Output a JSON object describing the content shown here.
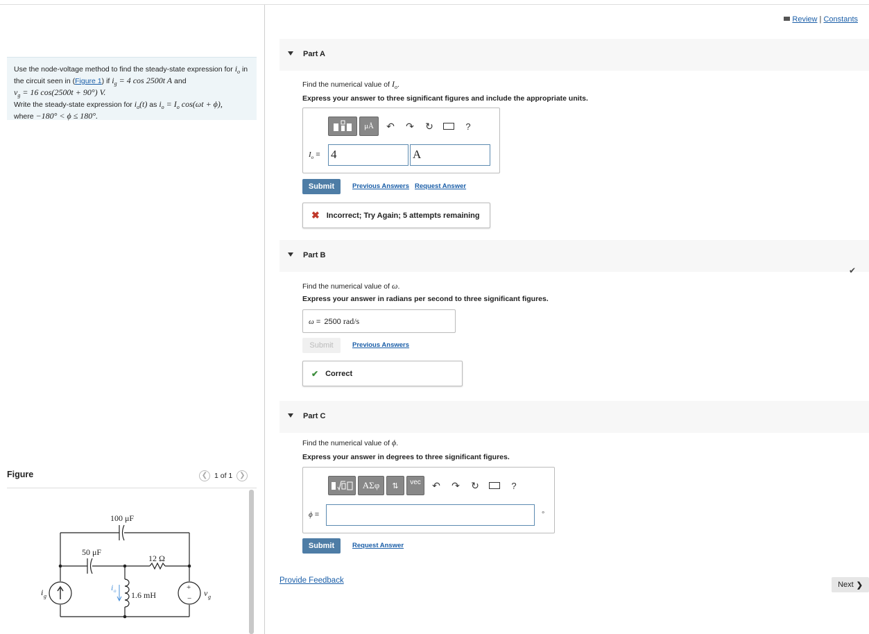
{
  "header": {
    "review": "Review",
    "sep": "|",
    "constants": "Constants"
  },
  "problem": {
    "line1_a": "Use the node-voltage method to find the steady-state expression for ",
    "line1_io": "i",
    "line1_io_sub": "o",
    "line1_b": " in",
    "line2_a": "the circuit seen in (",
    "line2_link": "Figure 1",
    "line2_b": ") if ",
    "line2_eq": "i",
    "line2_eq_sub": "g",
    "line2_eq2": " = 4 cos 2500t A",
    "line2_c": " and",
    "line3_eq": "v",
    "line3_eq_sub": "g",
    "line3_eq2": " = 16 cos(2500t + 90°) V.",
    "line4_a": "Write the steady-state expression for ",
    "line4_eq1": "i",
    "line4_eq1_sub": "o",
    "line4_eq1b": "(t)",
    "line4_b": " as ",
    "line4_eq2": "i",
    "line4_eq2_sub": "o",
    "line4_eq2b": " = I",
    "line4_eq2_sub2": "o",
    "line4_eq2c": " cos(ωt + ϕ),",
    "line5_a": "where ",
    "line5_eq": "−180° < ϕ ≤ 180°."
  },
  "figure": {
    "title": "Figure",
    "pager": "1 of 1",
    "labels": {
      "c100": "100 μF",
      "c50": "50 μF",
      "r12": "12 Ω",
      "l": "1.6 mH",
      "ig": "i",
      "ig_sub": "g",
      "vg": "v",
      "vg_sub": "g",
      "io": "i",
      "io_sub": "o",
      "plus": "+",
      "minus": "−"
    }
  },
  "partA": {
    "label": "Part A",
    "q1_a": "Find the numerical value of ",
    "q1_var": "I",
    "q1_var_sub": "o",
    "q1_b": ".",
    "q2": "Express your answer to three significant figures and include the appropriate units.",
    "toolbar": {
      "units": "μÅ",
      "help": "?"
    },
    "field_label": "I",
    "field_label_sub": "o",
    "field_eq": " =",
    "value": "4",
    "unit": "A",
    "submit": "Submit",
    "prev": "Previous Answers",
    "request": "Request Answer",
    "feedback": "Incorrect; Try Again; 5 attempts remaining"
  },
  "partB": {
    "label": "Part B",
    "q1_a": "Find the numerical value of ",
    "q1_var": "ω",
    "q1_b": ".",
    "q2": "Express your answer in radians per second to three significant figures.",
    "field_label": "ω",
    "field_eq": " = ",
    "value": "2500",
    "unit": "rad/s",
    "submit": "Submit",
    "prev": "Previous Answers",
    "feedback": "Correct"
  },
  "partC": {
    "label": "Part C",
    "q1_a": "Find the numerical value of ",
    "q1_var": "ϕ",
    "q1_b": ".",
    "q2": "Express your answer in degrees to three significant figures.",
    "toolbar": {
      "greek": "AΣφ",
      "vec": "vec",
      "help": "?"
    },
    "field_label": "ϕ",
    "field_eq": " =",
    "unit": "∘",
    "submit": "Submit",
    "request": "Request Answer"
  },
  "footer": {
    "feedback": "Provide Feedback",
    "next": "Next"
  }
}
